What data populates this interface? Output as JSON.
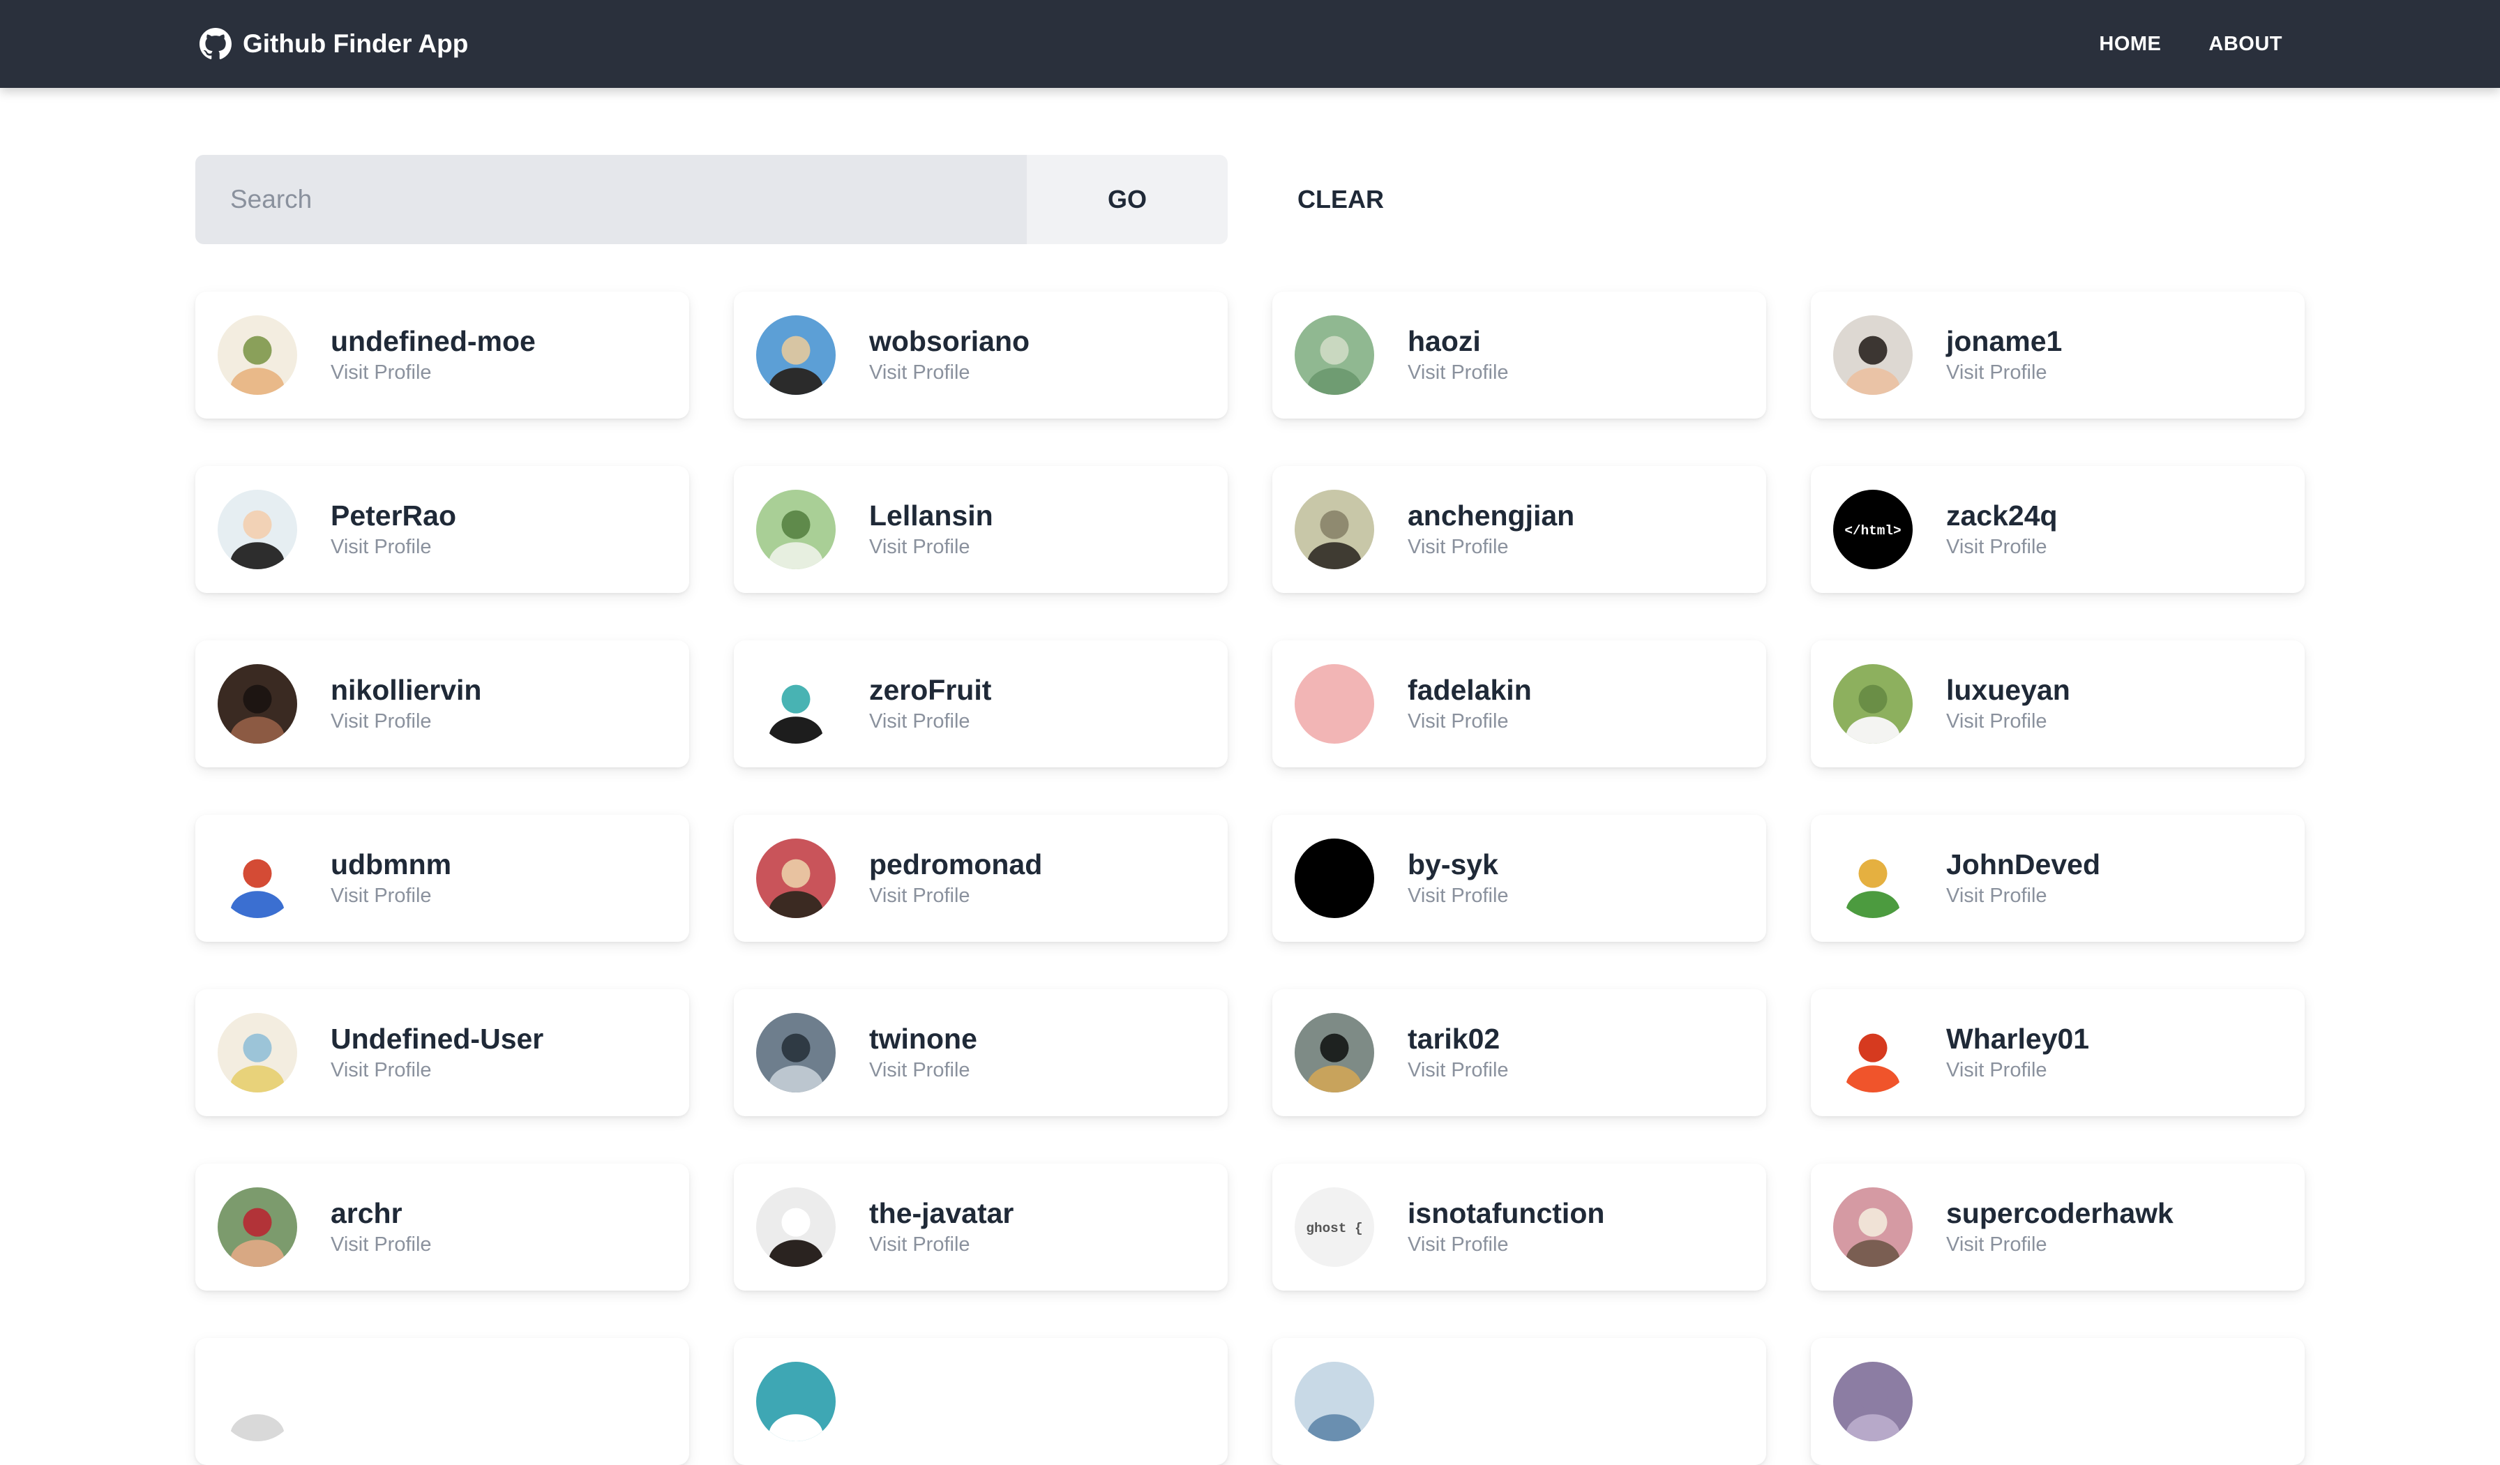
{
  "navbar": {
    "brand": "Github Finder App",
    "brand_icon": "github-icon",
    "links": [
      "HOME",
      "ABOUT"
    ]
  },
  "search": {
    "placeholder": "Search",
    "value": "",
    "go_label": "GO",
    "clear_label": "CLEAR"
  },
  "users": [
    {
      "login": "undefined-moe",
      "link": "Visit Profile",
      "avatar": {
        "colors": [
          "#f3ede0",
          "#e9b989",
          "#8aa05a"
        ]
      }
    },
    {
      "login": "wobsoriano",
      "link": "Visit Profile",
      "avatar": {
        "colors": [
          "#5c9fd6",
          "#2b2b2b",
          "#d7c5a3"
        ]
      }
    },
    {
      "login": "haozi",
      "link": "Visit Profile",
      "avatar": {
        "colors": [
          "#90b891",
          "#6f9c72",
          "#c9d8c0"
        ]
      }
    },
    {
      "login": "joname1",
      "link": "Visit Profile",
      "avatar": {
        "colors": [
          "#ddd8d2",
          "#eac3a6",
          "#3c3632"
        ]
      }
    },
    {
      "login": "PeterRao",
      "link": "Visit Profile",
      "avatar": {
        "colors": [
          "#e6eef2",
          "#2d2d2d",
          "#f2d2b6"
        ]
      }
    },
    {
      "login": "Lellansin",
      "link": "Visit Profile",
      "avatar": {
        "colors": [
          "#a9cf96",
          "#e7efe0",
          "#5f8a4b"
        ]
      }
    },
    {
      "login": "anchengjian",
      "link": "Visit Profile",
      "avatar": {
        "colors": [
          "#c8c7a8",
          "#3f3b32",
          "#8f8a70"
        ]
      }
    },
    {
      "login": "zack24q",
      "link": "Visit Profile",
      "avatar": {
        "colors": [
          "#000000",
          "#ffffff",
          "#000000"
        ],
        "text": "</html>"
      }
    },
    {
      "login": "nikolliervin",
      "link": "Visit Profile",
      "avatar": {
        "colors": [
          "#3a2a22",
          "#8c5a43",
          "#1d1512"
        ]
      }
    },
    {
      "login": "zeroFruit",
      "link": "Visit Profile",
      "avatar": {
        "colors": [
          "#ffffff",
          "#1d1d1d",
          "#48b3b3"
        ]
      }
    },
    {
      "login": "fadelakin",
      "link": "Visit Profile",
      "avatar": {
        "colors": [
          "#f2b5b5",
          "#f2b5b5",
          "#f2b5b5"
        ]
      }
    },
    {
      "login": "luxueyan",
      "link": "Visit Profile",
      "avatar": {
        "colors": [
          "#8db05e",
          "#f4f4f2",
          "#6a8e46"
        ]
      }
    },
    {
      "login": "udbmnm",
      "link": "Visit Profile",
      "avatar": {
        "colors": [
          "#ffffff",
          "#3b6fd1",
          "#d44b35"
        ]
      }
    },
    {
      "login": "pedromonad",
      "link": "Visit Profile",
      "avatar": {
        "colors": [
          "#c9545a",
          "#3b2a22",
          "#e8c2a0"
        ]
      }
    },
    {
      "login": "by-syk",
      "link": "Visit Profile",
      "avatar": {
        "colors": [
          "#000000",
          "#000000",
          "#000000"
        ]
      }
    },
    {
      "login": "JohnDeved",
      "link": "Visit Profile",
      "avatar": {
        "colors": [
          "#ffffff",
          "#4c9b3f",
          "#e5b040"
        ]
      }
    },
    {
      "login": "Undefined-User",
      "link": "Visit Profile",
      "avatar": {
        "colors": [
          "#f3ede0",
          "#e8d27a",
          "#9cc4d8"
        ]
      }
    },
    {
      "login": "twinone",
      "link": "Visit Profile",
      "avatar": {
        "colors": [
          "#6e7e8d",
          "#bcc6cf",
          "#2f3a44"
        ]
      }
    },
    {
      "login": "tarik02",
      "link": "Visit Profile",
      "avatar": {
        "colors": [
          "#7e8b86",
          "#c8a35c",
          "#1e2220"
        ]
      }
    },
    {
      "login": "Wharley01",
      "link": "Visit Profile",
      "avatar": {
        "colors": [
          "#ffffff",
          "#f0542b",
          "#d63a1f"
        ]
      }
    },
    {
      "login": "archr",
      "link": "Visit Profile",
      "avatar": {
        "colors": [
          "#7c9b6d",
          "#d8a883",
          "#b23338"
        ]
      }
    },
    {
      "login": "the-javatar",
      "link": "Visit Profile",
      "avatar": {
        "colors": [
          "#ececec",
          "#2a2320",
          "#ffffff"
        ]
      }
    },
    {
      "login": "isnotafunction",
      "link": "Visit Profile",
      "avatar": {
        "colors": [
          "#f2f2f2",
          "#555555",
          "#f2f2f2"
        ],
        "text": "ghost {"
      }
    },
    {
      "login": "supercoderhawk",
      "link": "Visit Profile",
      "avatar": {
        "colors": [
          "#d59aa3",
          "#7a5e52",
          "#f0e2d6"
        ]
      }
    },
    {
      "login": "",
      "link": "",
      "avatar": {
        "colors": [
          "#ffffff",
          "#d9d9d9",
          "#ffffff"
        ]
      }
    },
    {
      "login": "",
      "link": "",
      "avatar": {
        "colors": [
          "#3ea7b4",
          "#ffffff",
          "#3ea7b4"
        ]
      }
    },
    {
      "login": "",
      "link": "",
      "avatar": {
        "colors": [
          "#c8d9e6",
          "#6a8fb0",
          "#c8d9e6"
        ]
      }
    },
    {
      "login": "",
      "link": "",
      "avatar": {
        "colors": [
          "#8c7da3",
          "#b7a9c9",
          "#8c7da3"
        ]
      }
    }
  ]
}
